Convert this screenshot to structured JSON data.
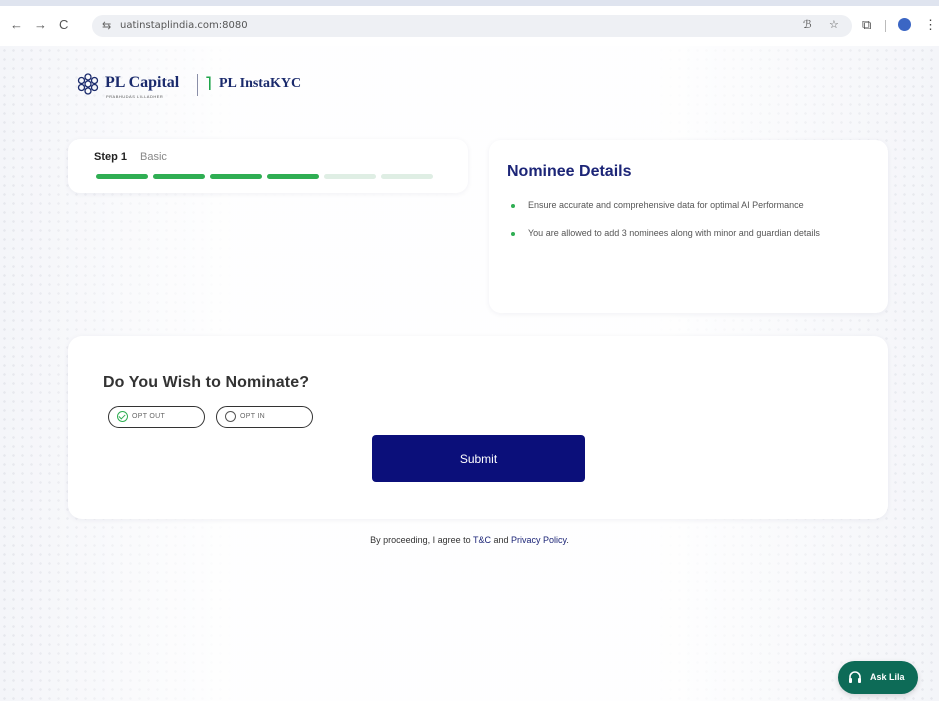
{
  "browser": {
    "back_icon": "←",
    "forward_icon": "→",
    "reload_icon": "C",
    "site_settings_icon": "⇆",
    "url": "uatinstaplindia.com:8080",
    "translate_icon": "ℬ",
    "bookmark_icon": "☆",
    "extensions_icon": "⧉",
    "menu_icon": "⋮"
  },
  "brand": {
    "primary_logo_text": "PL Capital",
    "primary_logo_tagline": "PRABHUDAS LILLADHER",
    "secondary_logo_text": "PL InstaKYC",
    "secondary_logo_check": "˥"
  },
  "progress": {
    "step_label": "Step 1",
    "step_name": "Basic",
    "total_segments": 6,
    "completed_segments": 4
  },
  "info": {
    "title": "Nominee Details",
    "points": [
      "Ensure accurate and comprehensive data for optimal AI Performance",
      "You are allowed to add 3 nominees along with minor and guardian details"
    ]
  },
  "nomination": {
    "question": "Do You Wish to Nominate?",
    "option_out": "OPT OUT",
    "option_in": "OPT IN",
    "selected": "OPT OUT",
    "submit_label": "Submit"
  },
  "consent": {
    "prefix": "By proceeding, I agree to ",
    "tnc": "T&C",
    "and": " and ",
    "privacy": "Privacy Policy",
    "suffix": "."
  },
  "assistant": {
    "label": "Ask Lila",
    "icon": "headset-icon"
  },
  "colors": {
    "brand_navy": "#1c2577",
    "submit_bg": "#0b0f7a",
    "progress_done": "#2fae53",
    "progress_todo": "#dfeee4",
    "assistant_bg": "#0d6b57"
  }
}
